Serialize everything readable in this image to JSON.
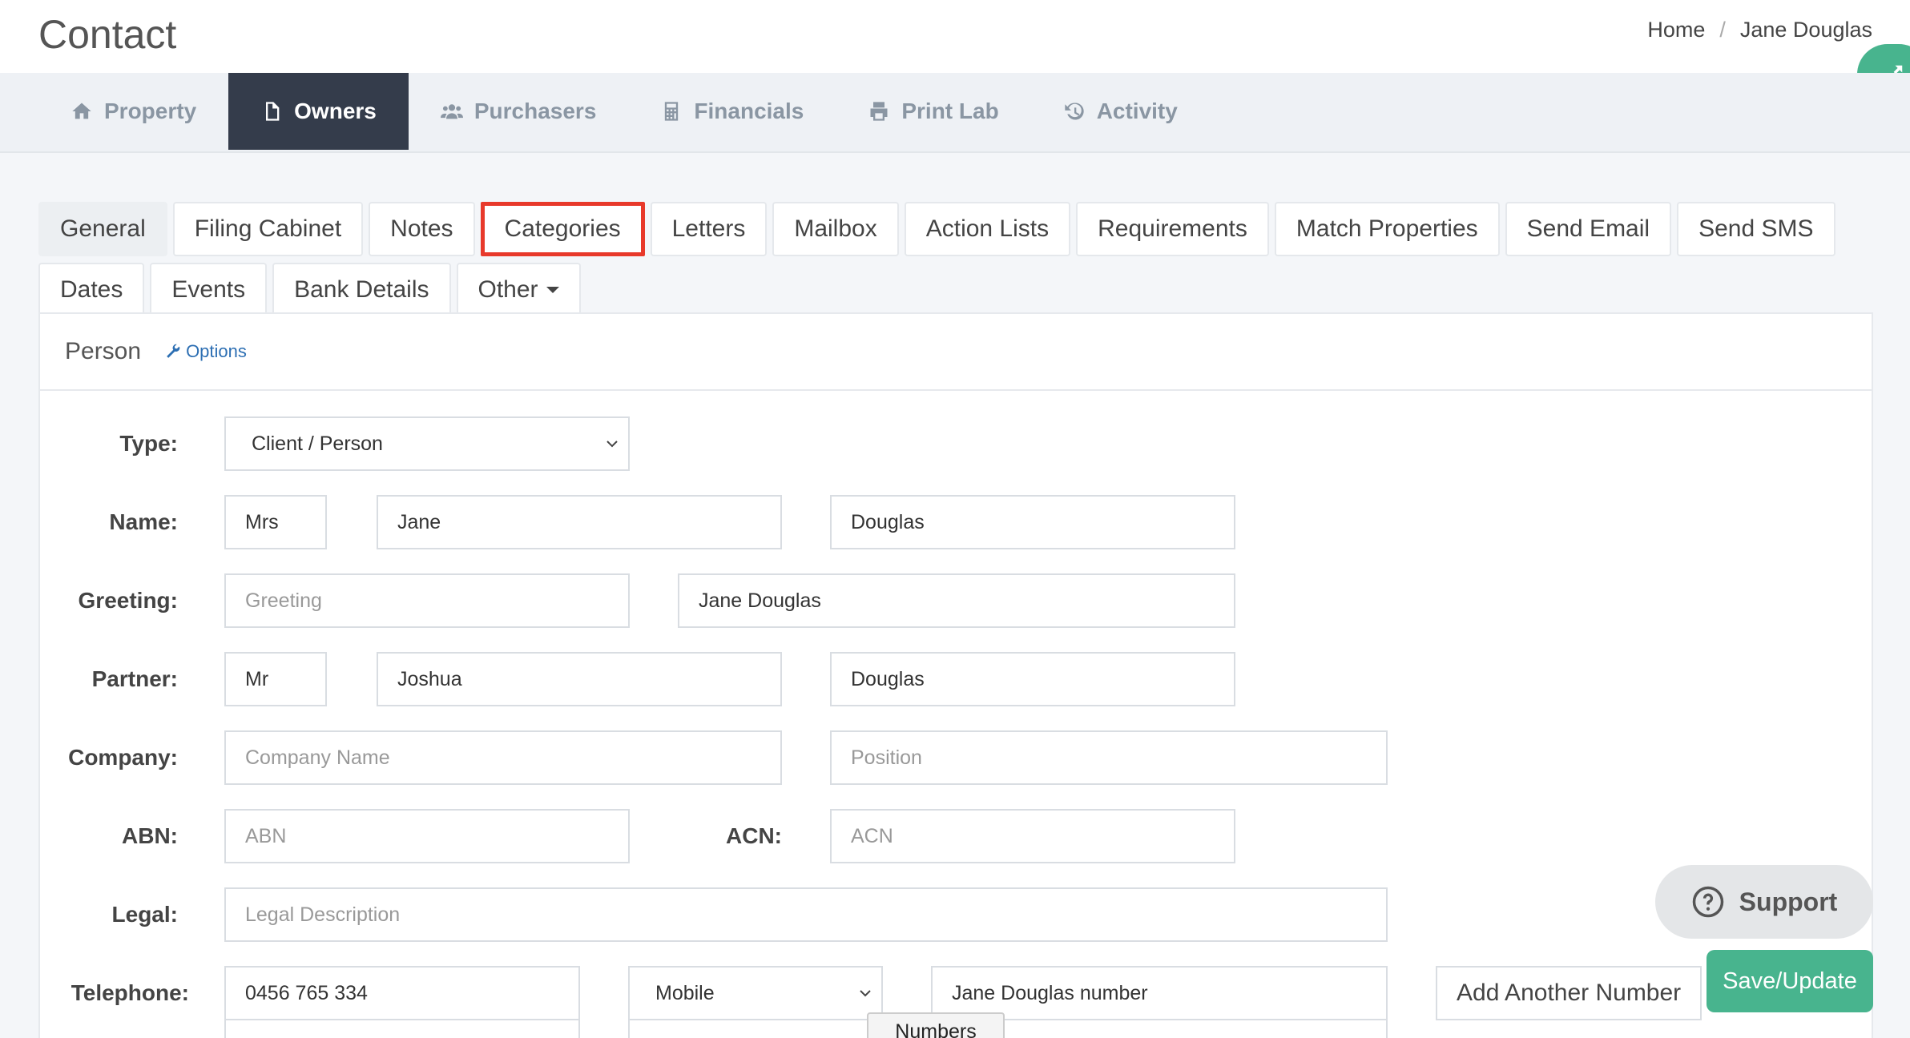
{
  "header": {
    "title": "Contact",
    "breadcrumb": {
      "home": "Home",
      "separator": "/",
      "current": "Jane Douglas"
    }
  },
  "main_nav": [
    {
      "label": "Property",
      "icon": "home-icon"
    },
    {
      "label": "Owners",
      "icon": "document-icon",
      "active": true
    },
    {
      "label": "Purchasers",
      "icon": "users-icon"
    },
    {
      "label": "Financials",
      "icon": "calculator-icon"
    },
    {
      "label": "Print Lab",
      "icon": "printer-icon"
    },
    {
      "label": "Activity",
      "icon": "history-icon"
    }
  ],
  "sub_tabs": [
    "General",
    "Filing Cabinet",
    "Notes",
    "Categories",
    "Letters",
    "Mailbox",
    "Action Lists",
    "Requirements",
    "Match Properties",
    "Send Email",
    "Send SMS",
    "Dates",
    "Events",
    "Bank Details",
    "Other"
  ],
  "sub_tabs_active": "General",
  "sub_tabs_highlighted": "Categories",
  "panel": {
    "title": "Person",
    "options_label": "Options"
  },
  "form": {
    "type": {
      "label": "Type:",
      "value": "Client / Person"
    },
    "name": {
      "label": "Name:",
      "title": "Mrs",
      "first": "Jane",
      "last": "Douglas"
    },
    "greeting": {
      "label": "Greeting:",
      "placeholder": "Greeting",
      "value": "Jane Douglas"
    },
    "partner": {
      "label": "Partner:",
      "title": "Mr",
      "first": "Joshua",
      "last": "Douglas"
    },
    "company": {
      "label": "Company:",
      "name_placeholder": "Company Name",
      "position_placeholder": "Position"
    },
    "abn": {
      "label": "ABN:",
      "placeholder": "ABN"
    },
    "acn": {
      "label": "ACN:",
      "placeholder": "ACN"
    },
    "legal": {
      "label": "Legal:",
      "placeholder": "Legal Description"
    },
    "telephone": {
      "label": "Telephone:",
      "number": "0456 765 334",
      "kind": "Mobile",
      "description": "Jane Douglas number"
    }
  },
  "buttons": {
    "add_number": "Add Another Number",
    "support": "Support",
    "save": "Save/Update"
  },
  "tooltip": "Numbers",
  "colors": {
    "accent_green": "#48b48e",
    "active_tab": "#343c4b",
    "highlight_red": "#e8392b"
  }
}
